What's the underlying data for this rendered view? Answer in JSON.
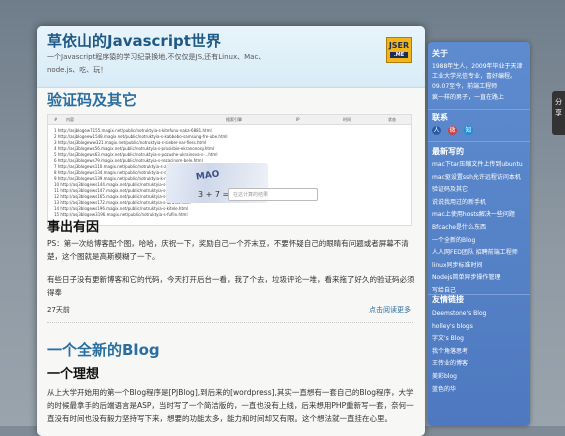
{
  "header": {
    "title": "草依山的Javascript世界",
    "desc": "一个Javascript程序猿的学习纪录换地,不仅仅是JS,还有Linux、Mac、node.js、吃、玩！",
    "logo_main": "JSER",
    "logo_sub": ".ME"
  },
  "post1": {
    "title": "验证码及其它",
    "screenshot": {
      "columns": [
        "#",
        "内容",
        "搜索引擎",
        "IP",
        "时间",
        "状态"
      ],
      "rows": [
        "1   http://asjblogew7155.magix.net/public/notruktyia-s-kitefunu-naka-6881.html",
        "2   http://asjblogeew1548.magix.net/public/notruktyia-s-kabbebo-samsung-fre-ube.html",
        "3   http://asj3blogeww321.magix.net/public/notruktyia-s-sieber-nar-fiess.html",
        "4   http://asj3blogews56.magix.net/public/notruktyia-s-prosisbie-ekranonosy.html",
        "5   http://asj3blogews63.magix.net/public/notruktyia-s-pozushe-ukraineva-s-...html",
        "6   http://asj3blogews79.magix.net/public/notruktyia-s-rezacinom-bele.html",
        "7   http://asj3blogews110.magix.net/public/notruktyia-s-zezrasi-i-s-...html",
        "8   http://asj3blogews134.magix.net/public/notruktyia-s-dezzpi.html",
        "9   http://asj3blogews139.magix.net/public/notruktyia-k-regulyatoru-skorosty.html",
        "10  http://asj3blogews144.magix.net/public/notruktyia-s-tepodoilnost.html",
        "11  http://asj3blogews147.magix.net/public/notruktyia-s-kmotr.html",
        "12  http://asj3blogews165.magix.net/public/notruktyia-s-zuma-lgp.html",
        "13  http://asj3blogews172.magix.net/public/notruktyia-s-ibrusts.html",
        "14  http://asj3blogews196.magix.net/public/notruktyia-s-kitele.html",
        "15  http://asj3blogew3196.magix.net/public/notruktyia-s-fufiin.html"
      ],
      "captcha_text": "MAO",
      "captcha_equation": "3 + 7 =",
      "captcha_placeholder": "在这计算的结果"
    },
    "heading": "事出有因",
    "paragraph1": "PS：第一次给博客配个图，哈哈，庆祝一下，奖励自己一个芥末豆，不要怀疑自己的眼睛有问题或者屏幕不清楚，这个图就是高斯模糊了一下。",
    "paragraph2": "有些日子没有更新博客和它的代码，今天打开后台一看，我了个去，垃圾评论一堆，看来拖了好久的验证码必须得奉",
    "date": "27天前",
    "read_more": "点击阅读更多"
  },
  "post2": {
    "title": "一个全新的Blog",
    "heading": "一个理想",
    "paragraph": "从上大学开始用的第一个Blog程序是[PJBlog],到后来的[wordpress],其实一直想有一套自己的Blog程序，大学的时候最拿手的后端语言是ASP，当时写了一个简洁版的，一直也没有上线，后来想用PHP重新写一套，奈何一直没有时间也没有毅力坚持写下来，想要的功能太多，能力和时间却又有限。这个想法就一直挂在心里。"
  },
  "sidebar": {
    "about_title": "关于",
    "about_text": "1988年生人，2009年毕业于天津工业大学光信专业，喜好编程。09.07至今，前端工程师",
    "about_text2": "疯一样的男子，一直在路上",
    "contact_title": "联系",
    "contact_icons": [
      "人",
      "微",
      "知"
    ],
    "recent_title": "最新写的",
    "recent": [
      "mac下tar压缩文件上传到ubuntu",
      "mac驱设置ssh允许远程访问本机",
      "验证码及其它",
      "说说我用过的新手机",
      "mac上使用hosts解决一些问题",
      "Bfcache是什么东西",
      "一个全新的Blog",
      "人人网FED团队 招聘前端工程师",
      "linux同步标准时间",
      "Nodejs简单异步操作管理",
      "写给自己"
    ],
    "friends_title": "友情链接",
    "friends": [
      "Deemstone's Blog",
      "holley's blogs",
      "字文's Blog",
      "我个角落思考",
      "王传业的博客",
      "美彩blog",
      "蓝色的华"
    ]
  },
  "share_label": "分享"
}
